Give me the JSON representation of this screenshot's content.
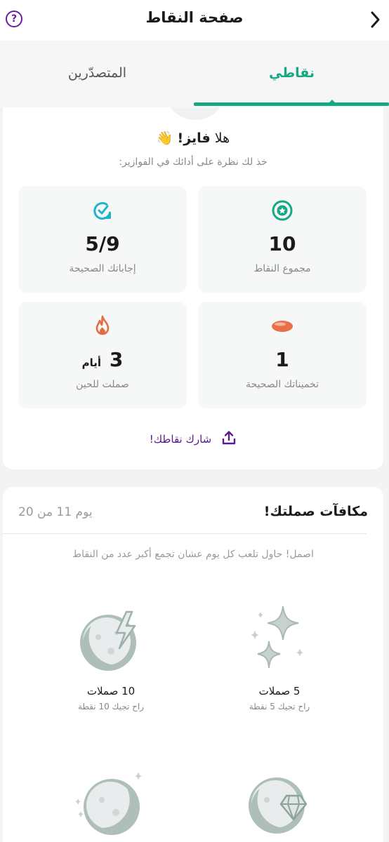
{
  "header": {
    "title": "صفحة النقاط",
    "help_label": "?"
  },
  "tabs": {
    "mine": "نقاطي",
    "leaderboard": "المتصدّرين"
  },
  "summary": {
    "greeting_prefix": "هلا",
    "greeting_name": "فايز!",
    "greeting_emoji": "👋",
    "subtitle": "خذ لك نظرة على أدائك في الفوازير:",
    "stats": [
      {
        "icon": "star-badge-icon",
        "value": "10",
        "label": "مجموع النقاط",
        "color": "#16a884"
      },
      {
        "icon": "check-bubble-icon",
        "value": "5/9",
        "label": "إجاباتك الصحيحة",
        "color": "#1fb5c9"
      },
      {
        "icon": "date-fruit-icon",
        "value": "1",
        "label": "تخميناتك الصحيحة",
        "color": "#e56b43"
      },
      {
        "icon": "flame-icon",
        "value": "3",
        "unit": "أيام",
        "label": "صملت للحين",
        "color": "#e56b43"
      }
    ],
    "share_label": "شارك نقاطك!"
  },
  "rewards": {
    "title": "مكافآت صملتك!",
    "day_progress": "يوم 11 من 20",
    "hint": "اصمل! حاول تلعب كل يوم عشان تجمع أكبر عدد من النقاط",
    "badges": [
      {
        "icon": "sparkles-icon",
        "name": "5 صملات",
        "points": "راح تجيك 5 نقطة"
      },
      {
        "icon": "moon-lightning-icon",
        "name": "10 صملات",
        "points": "راح تجيك 10 نقطة"
      },
      {
        "icon": "moon-gem-icon",
        "name": "",
        "points": ""
      },
      {
        "icon": "moon-stars-icon",
        "name": "",
        "points": ""
      }
    ]
  },
  "colors": {
    "accent": "#16a884",
    "purple": "#5d1a90"
  }
}
